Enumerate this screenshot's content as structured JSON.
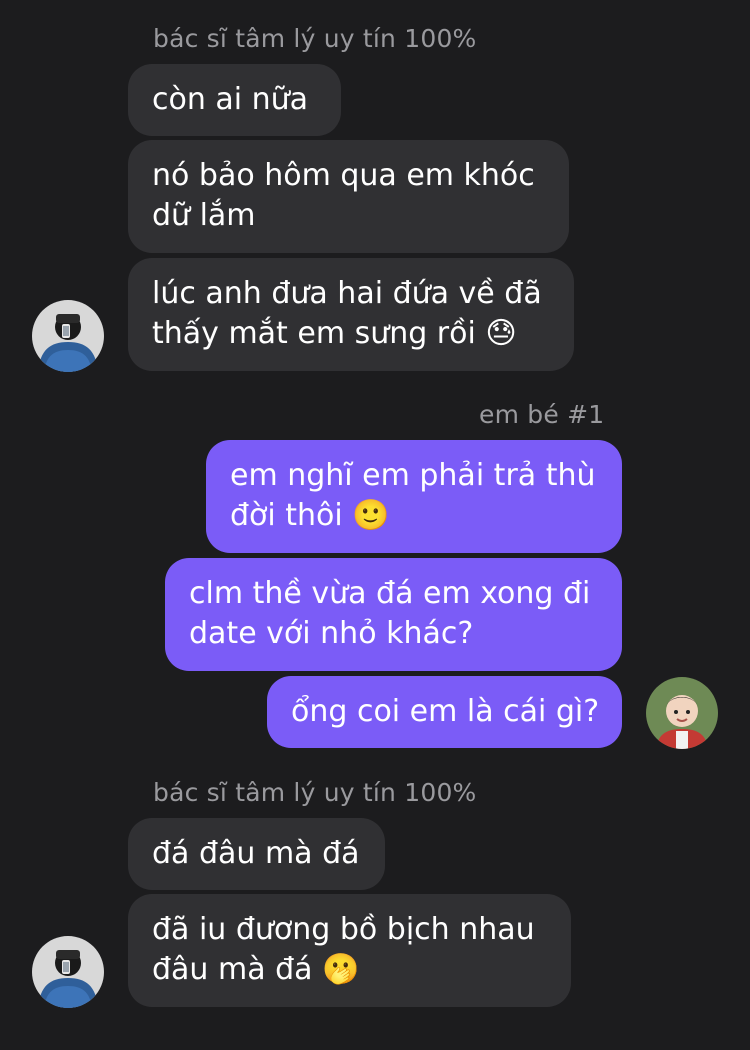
{
  "thread": {
    "group1": {
      "sender": "bác sĩ tâm lý uy tín 100%",
      "messages": [
        {
          "line1": "còn ai nữa"
        },
        {
          "line1": "nó bảo hôm qua em khóc",
          "line2": "dữ lắm"
        },
        {
          "line1": "lúc anh đưa hai đứa về đã",
          "line2": "thấy mắt em sưng rồi",
          "emoji": "😓"
        }
      ]
    },
    "group2": {
      "sender": "em bé #1",
      "messages": [
        {
          "line1": "em nghĩ em phải trả thù",
          "line2": "đời thôi",
          "emoji": "🙂"
        },
        {
          "line1": "clm thề vừa đá em xong đi",
          "line2": "date với nhỏ khác?"
        },
        {
          "line1": "ổng coi em là cái gì?"
        }
      ]
    },
    "group3": {
      "sender": "bác sĩ tâm lý uy tín 100%",
      "messages": [
        {
          "line1": "đá đâu mà đá"
        },
        {
          "line1": "đã iu đương bồ bịch nhau",
          "line2": "đâu mà đá",
          "emoji": "🫢"
        }
      ]
    }
  },
  "avatars": {
    "contact_icon": "person-hoodie-avatar",
    "self_icon": "child-avatar"
  },
  "colors": {
    "background": "#1c1c1e",
    "incoming_bubble": "#303033",
    "outgoing_bubble": "#7b5cf7",
    "sender_name": "#9a9a9e"
  }
}
